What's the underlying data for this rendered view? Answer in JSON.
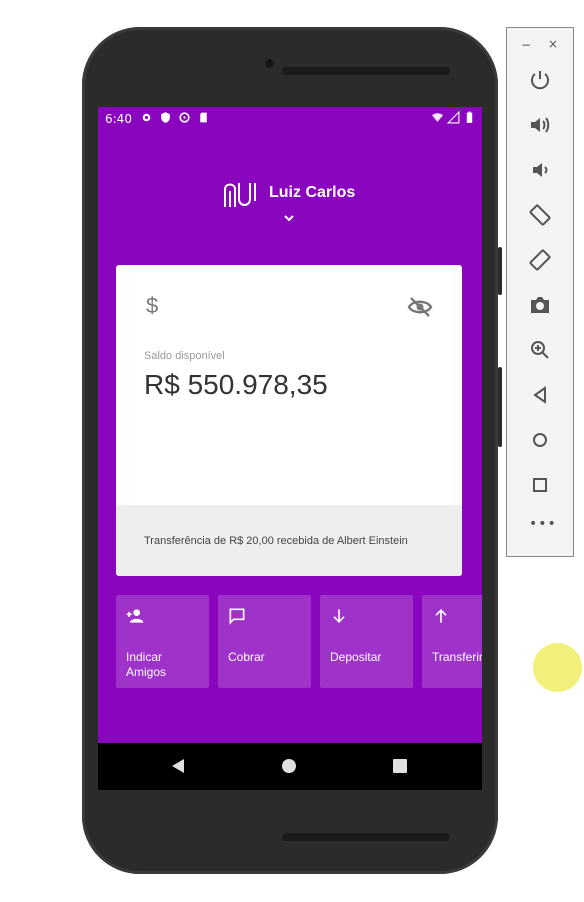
{
  "statusbar": {
    "time": "6:40"
  },
  "header": {
    "user_name": "Luiz Carlos"
  },
  "card": {
    "currency_symbol": "$",
    "balance_label": "Saldo disponível",
    "balance": "R$ 550.978,35",
    "last_transaction": "Transferência de R$ 20,00 recebida de Albert Einstein"
  },
  "shortcuts": [
    {
      "label": "Indicar\nAmigos",
      "icon": "person-add-icon"
    },
    {
      "label": "Cobrar",
      "icon": "chat-icon"
    },
    {
      "label": "Depositar",
      "icon": "arrow-down-icon"
    },
    {
      "label": "Transferir",
      "icon": "arrow-up-icon"
    }
  ],
  "emulator": {
    "minimize": "−",
    "close": "×",
    "more": "•••"
  },
  "colors": {
    "primary": "#8a05be",
    "card": "#ffffff",
    "card_footer": "#eeeeee"
  }
}
